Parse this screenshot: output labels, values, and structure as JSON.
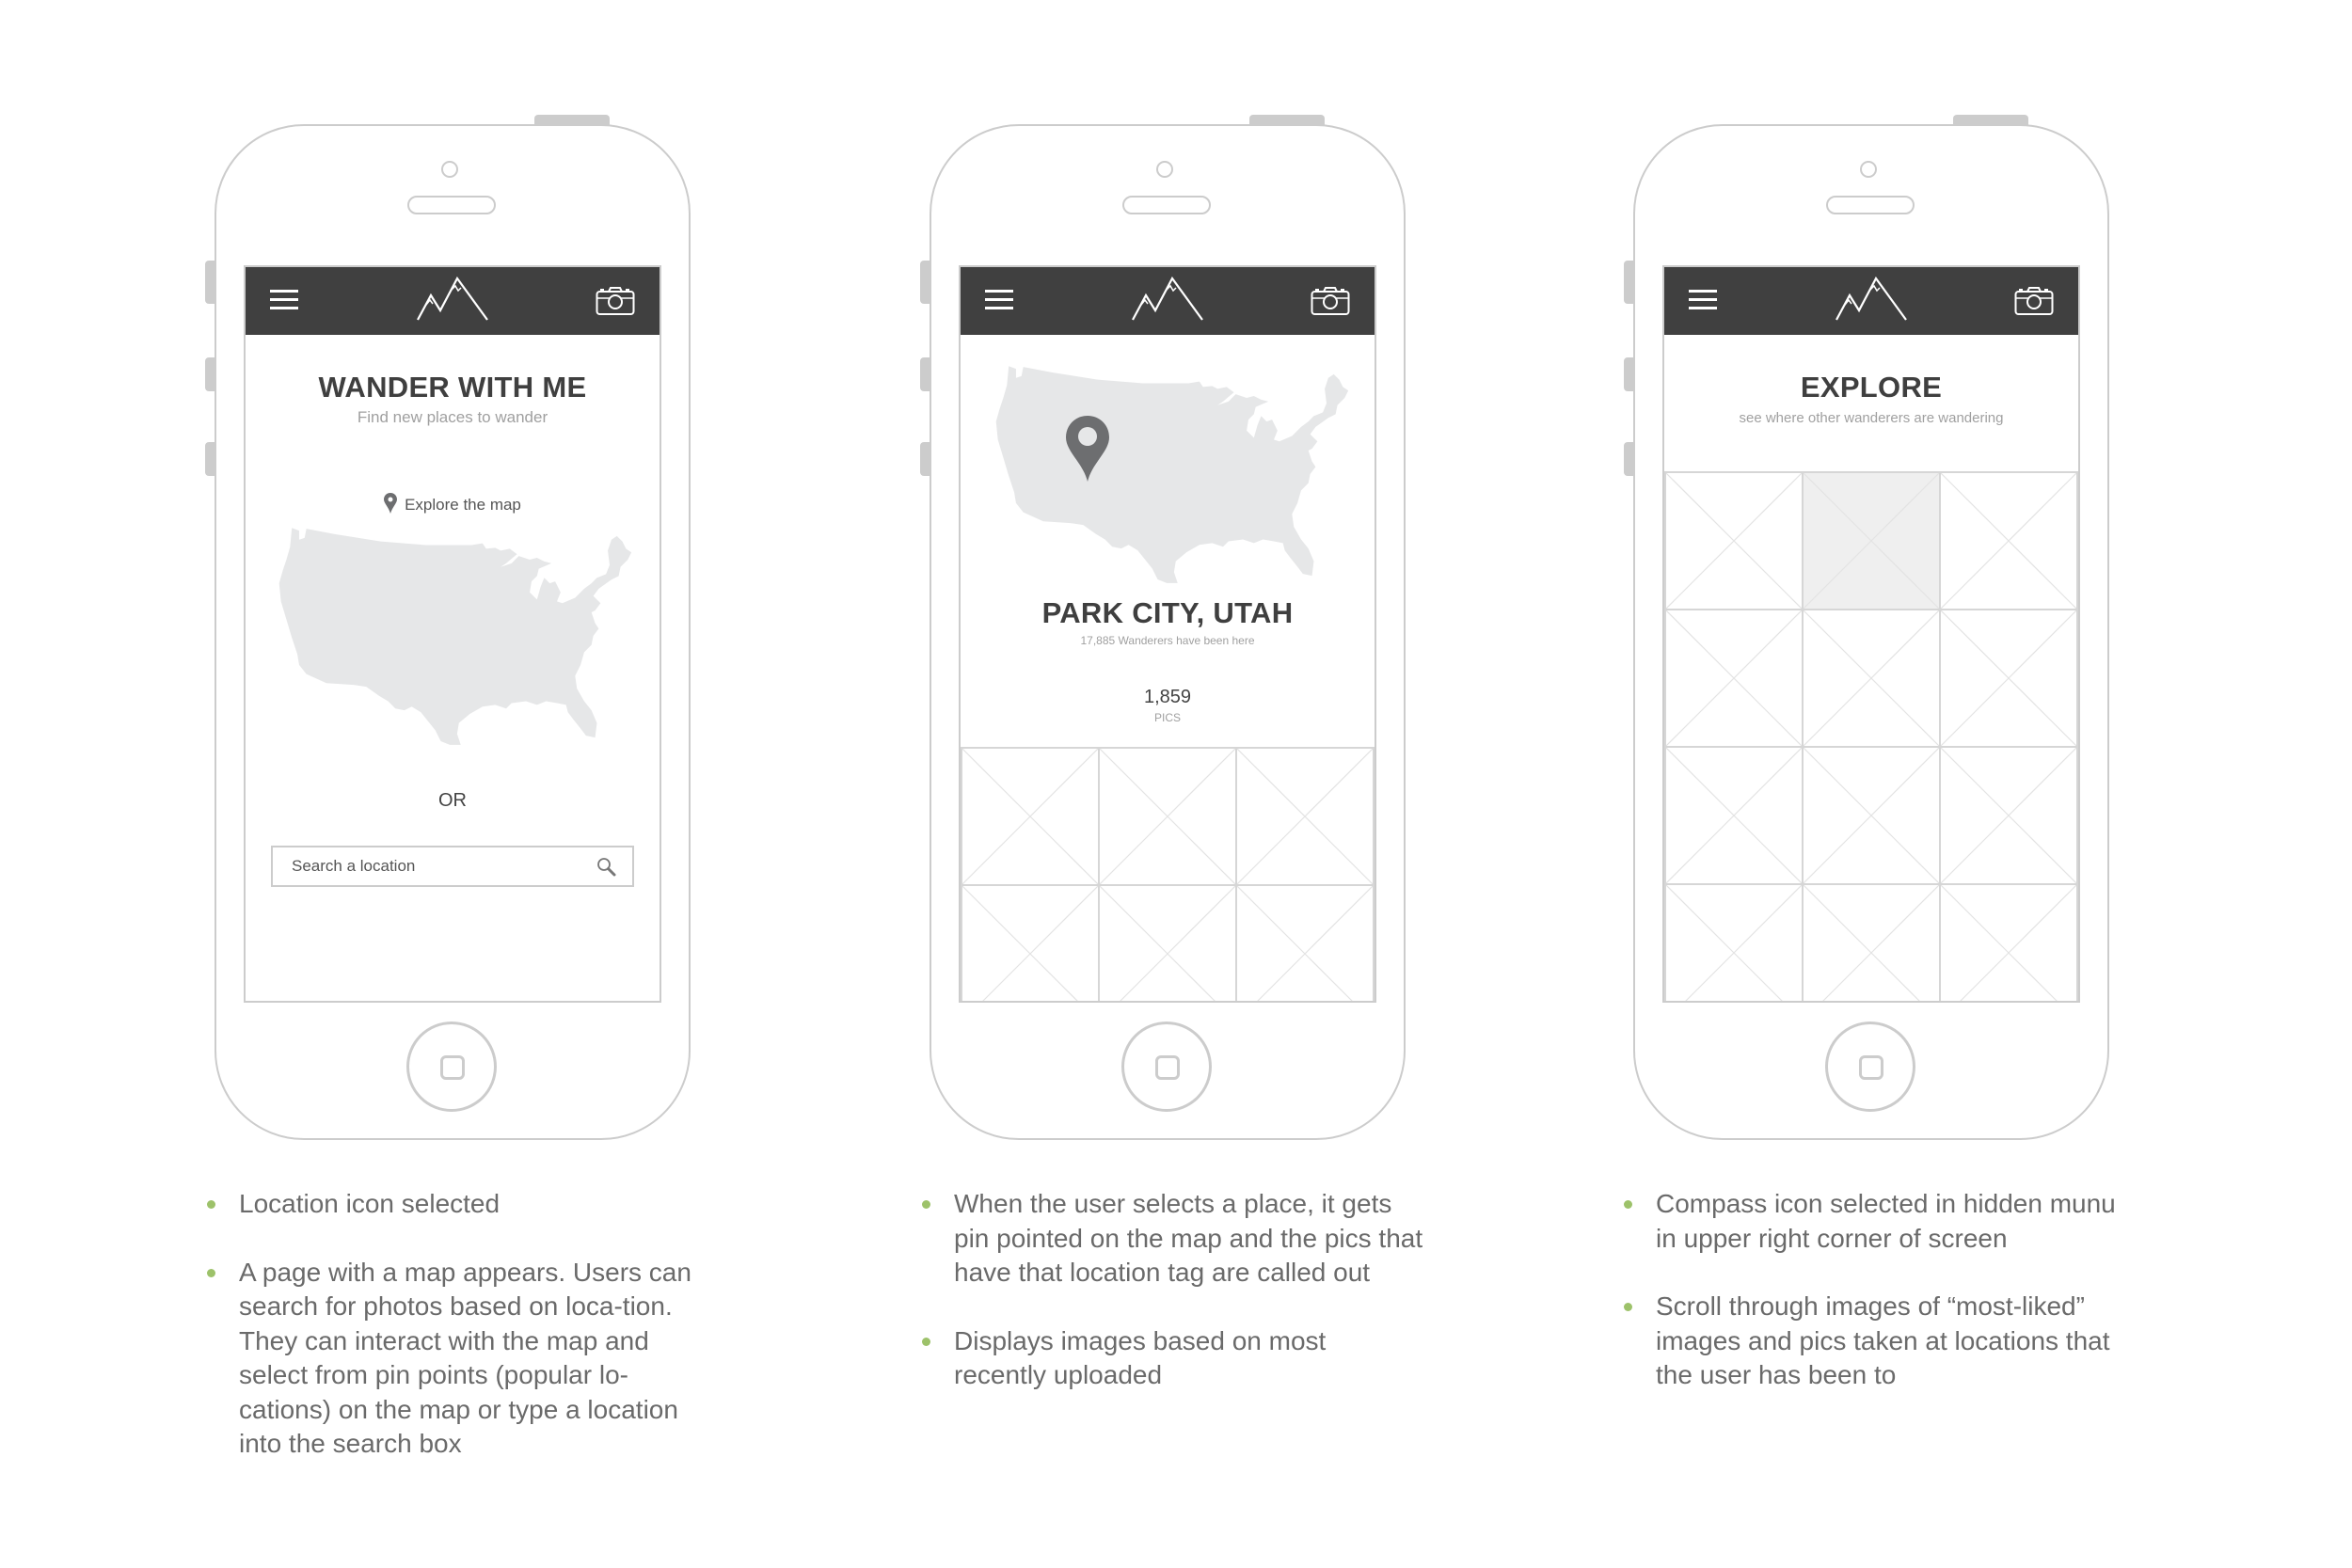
{
  "colors": {
    "header_bg": "#404040",
    "outline": "#cccccc",
    "map_fill": "#e6e7e8",
    "pin": "#6d6e70",
    "title_text": "#3f3f3f",
    "subtitle_text": "#a0a0a0",
    "note_text": "#6a6a6a",
    "bullet": "#9dc26a"
  },
  "icons": {
    "menu": "hamburger-menu-icon",
    "logo": "mountain-logo-icon",
    "camera": "camera-icon",
    "pin": "map-pin-icon",
    "search": "magnifier-search-icon",
    "placeholder": "image-placeholder-x-icon"
  },
  "screens": [
    {
      "title": "WANDER WITH ME",
      "subtitle": "Find new places to wander",
      "explore_link": "Explore the map",
      "or_label": "OR",
      "search": {
        "placeholder": "Search a location",
        "value": ""
      },
      "notes": [
        "Location icon selected",
        "A page with a map appears. Users can search for photos based on loca-tion. They can interact with the map and select from pin points (popular lo-cations) on the map or type a location into the search box"
      ]
    },
    {
      "title": "PARK CITY, UTAH",
      "subtitle": "17,885 Wanderers have been here",
      "pics_count": "1,859",
      "pics_label": "PICS",
      "grid": {
        "columns": 3,
        "rows_visible": 2,
        "filled_cells": []
      },
      "notes": [
        "When the user selects a place, it gets pin pointed on the map and the pics that have that location tag are called out",
        "Displays images based on most recently uploaded"
      ]
    },
    {
      "title": "EXPLORE",
      "subtitle": "see where other wanderers are wandering",
      "grid": {
        "columns": 3,
        "rows_visible": 4,
        "filled_cells": [
          1
        ]
      },
      "notes": [
        "Compass icon selected in hidden munu in upper right corner of screen",
        "Scroll through images of “most-liked” images and pics taken at locations that the user has been to"
      ]
    }
  ]
}
